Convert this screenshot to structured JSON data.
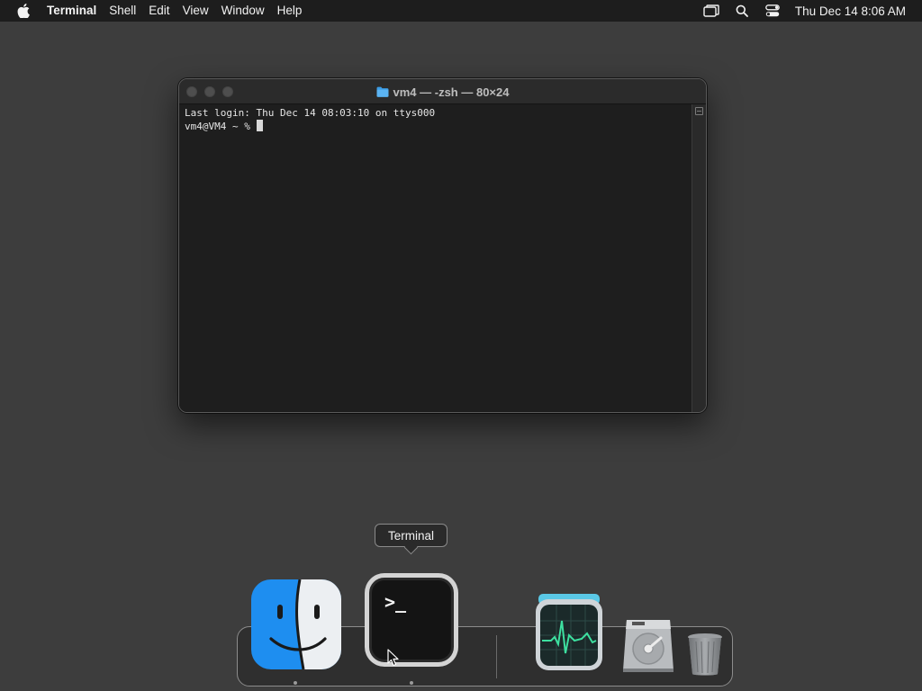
{
  "menubar": {
    "app_name": "Terminal",
    "menus": [
      "Shell",
      "Edit",
      "View",
      "Window",
      "Help"
    ],
    "status_icons": [
      "screen-mirroring-icon",
      "spotlight-search-icon",
      "control-center-icon"
    ],
    "clock": "Thu Dec 14  8:06 AM"
  },
  "window": {
    "title": "vm4 — -zsh — 80×24",
    "lines": [
      "Last login: Thu Dec 14 08:03:10 on ttys000",
      "vm4@VM4 ~ % "
    ]
  },
  "tooltip": {
    "label": "Terminal"
  },
  "dock": {
    "items": [
      {
        "name": "Finder",
        "icon": "finder-icon",
        "running": true
      },
      {
        "name": "Terminal",
        "icon": "terminal-icon",
        "running": true,
        "prompt_glyph": ">_"
      },
      {
        "name": "Activity Monitor",
        "icon": "activity-monitor-icon",
        "running": false
      },
      {
        "name": "Disk",
        "icon": "hard-disk-icon",
        "running": false
      },
      {
        "name": "Trash",
        "icon": "trash-icon",
        "running": false
      }
    ]
  },
  "colors": {
    "desktop": "#3d3d3d",
    "menubar": "#1d1d1d",
    "terminal_bg": "#1e1e1e",
    "finder_blue": "#1e8ef0",
    "activity_green": "#3de0a0"
  }
}
